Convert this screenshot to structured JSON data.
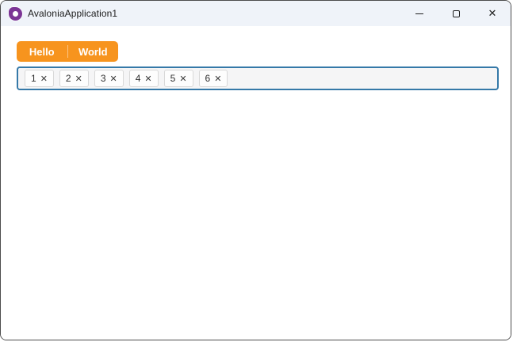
{
  "window": {
    "title": "AvaloniaApplication1",
    "controls": {
      "close_icon": "✕"
    }
  },
  "tab_strip": {
    "tabs": [
      {
        "label": "Hello"
      },
      {
        "label": "World"
      }
    ]
  },
  "chip_input": {
    "chips": [
      {
        "label": "1",
        "remove_icon": "✕"
      },
      {
        "label": "2",
        "remove_icon": "✕"
      },
      {
        "label": "3",
        "remove_icon": "✕"
      },
      {
        "label": "4",
        "remove_icon": "✕"
      },
      {
        "label": "5",
        "remove_icon": "✕"
      },
      {
        "label": "6",
        "remove_icon": "✕"
      }
    ]
  },
  "colors": {
    "tab_accent": "#F7941E",
    "chip_container_border": "#3579A8",
    "titlebar_bg": "#EFF3F9",
    "window_border": "#4D4D4D",
    "logo_purple": "#7B3596"
  }
}
